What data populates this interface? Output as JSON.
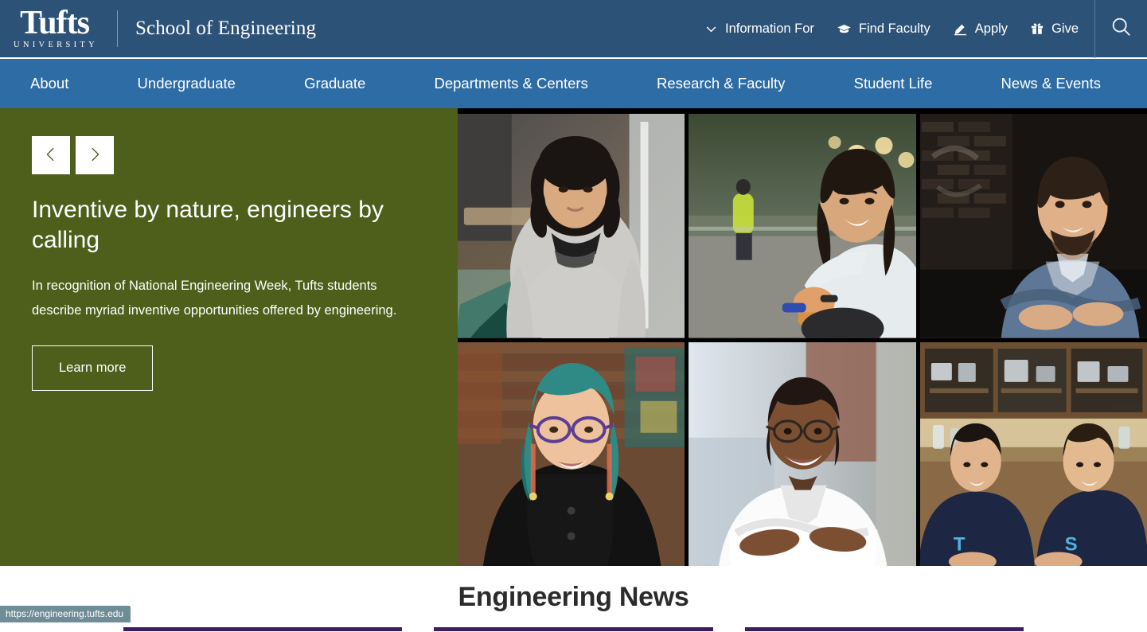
{
  "header": {
    "logo_word": "Tufts",
    "logo_sub": "UNIVERSITY",
    "site_title": "School of Engineering",
    "utility_nav": [
      {
        "label": "Information For",
        "icon": "chevron-down-icon"
      },
      {
        "label": "Find Faculty",
        "icon": "graduation-cap-icon"
      },
      {
        "label": "Apply",
        "icon": "pencil-icon"
      },
      {
        "label": "Give",
        "icon": "gift-icon"
      }
    ],
    "search_icon": "search-icon",
    "bg_color": "#2d5277"
  },
  "main_nav": {
    "bg_color": "#2d6ca4",
    "items": [
      {
        "label": "About"
      },
      {
        "label": "Undergraduate"
      },
      {
        "label": "Graduate"
      },
      {
        "label": "Departments & Centers"
      },
      {
        "label": "Research & Faculty"
      },
      {
        "label": "Student Life"
      },
      {
        "label": "News & Events"
      }
    ]
  },
  "hero": {
    "bg_color": "#4d5f1b",
    "prev_label": "Previous slide",
    "next_label": "Next slide",
    "title": "Inventive by nature, engineers by calling",
    "description": "In recognition of National Engineering Week, Tufts students describe myriad inventive opportunities offered by engineering.",
    "cta_label": "Learn more",
    "photos": [
      {
        "alt": "Student with curly dark hair in gray sweater in a workshop"
      },
      {
        "alt": "Student smiling outdoors at dusk with string lights"
      },
      {
        "alt": "Man in blue button-down shirt leaning against a brick wall"
      },
      {
        "alt": "Person with teal hair and glasses wearing a black top"
      },
      {
        "alt": "Man in white polo shirt with arms crossed outdoors"
      },
      {
        "alt": "Two students in Tufts sweatshirts seated in a lab"
      }
    ]
  },
  "news": {
    "heading": "Engineering News",
    "accent_color": "#3f1d5e",
    "cards": [
      {},
      {},
      {}
    ]
  },
  "status_bar": {
    "url": "https://engineering.tufts.edu"
  }
}
